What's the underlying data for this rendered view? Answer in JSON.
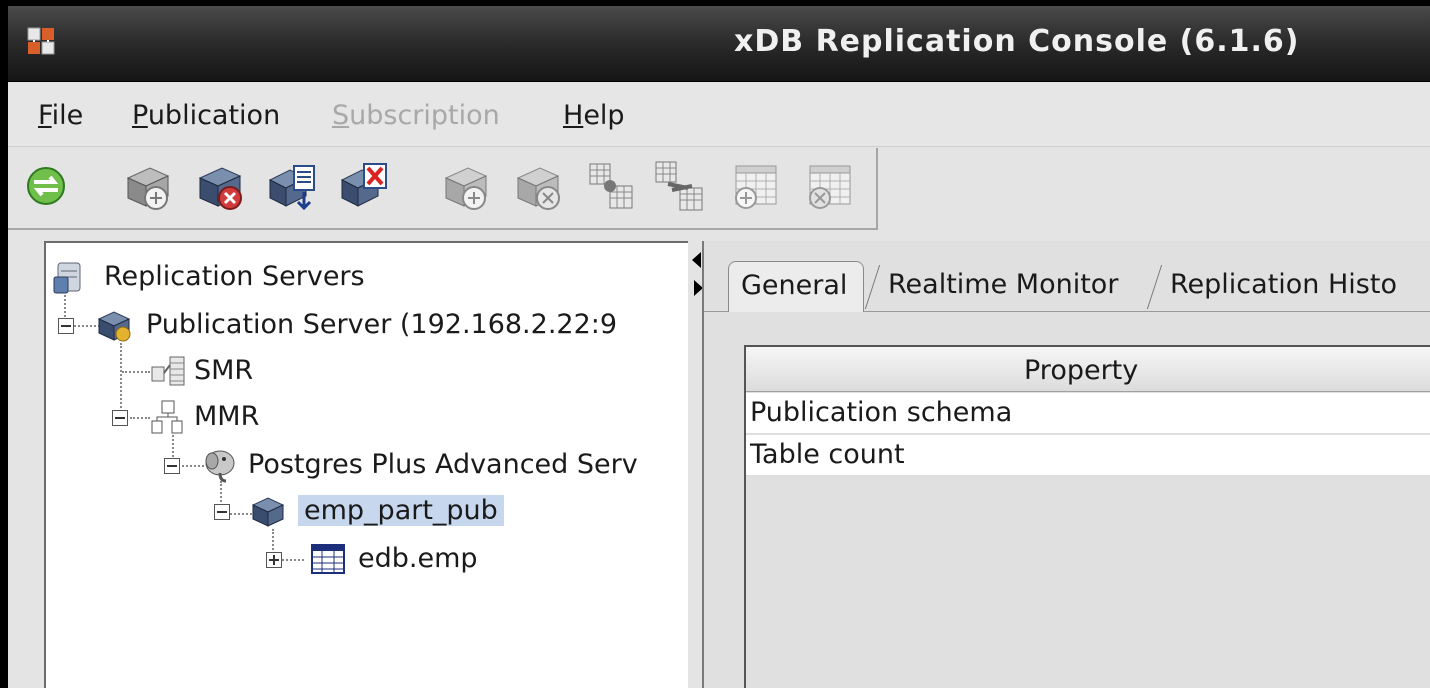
{
  "window": {
    "title": "xDB Replication Console (6.1.6)",
    "app_icon": "xdb-app-icon"
  },
  "menu": {
    "file": {
      "mnemonic": "F",
      "rest": "ile"
    },
    "publication": {
      "mnemonic": "P",
      "rest": "ublication"
    },
    "subscription": {
      "mnemonic": "S",
      "rest": "ubscription",
      "disabled": true
    },
    "help": {
      "mnemonic": "H",
      "rest": "elp"
    }
  },
  "toolbar": {
    "buttons": [
      {
        "icon": "refresh-icon",
        "enabled": true
      },
      {
        "icon": "add-publication-icon",
        "enabled": true
      },
      {
        "icon": "remove-publication-icon",
        "enabled": true
      },
      {
        "icon": "update-publication-icon",
        "enabled": true
      },
      {
        "icon": "validate-publication-icon",
        "enabled": true
      },
      {
        "icon": "add-subscription-icon",
        "enabled": false
      },
      {
        "icon": "remove-subscription-icon",
        "enabled": false
      },
      {
        "icon": "snapshot-icon",
        "enabled": false
      },
      {
        "icon": "synchronize-icon",
        "enabled": false
      },
      {
        "icon": "add-schedule-icon",
        "enabled": false
      },
      {
        "icon": "remove-schedule-icon",
        "enabled": false
      }
    ]
  },
  "tree": {
    "root": "Replication Servers",
    "publication_server": "Publication Server (192.168.2.22:9",
    "smr": "SMR",
    "mmr": "MMR",
    "database": "Postgres Plus Advanced Serv",
    "publication": "emp_part_pub",
    "table": "edb.emp"
  },
  "tabs": [
    {
      "label": "General",
      "active": true
    },
    {
      "label": "Realtime Monitor",
      "active": false
    },
    {
      "label": "Replication Histo",
      "active": false
    }
  ],
  "properties": {
    "header": "Property",
    "rows": [
      "Publication schema",
      "Table count"
    ]
  }
}
